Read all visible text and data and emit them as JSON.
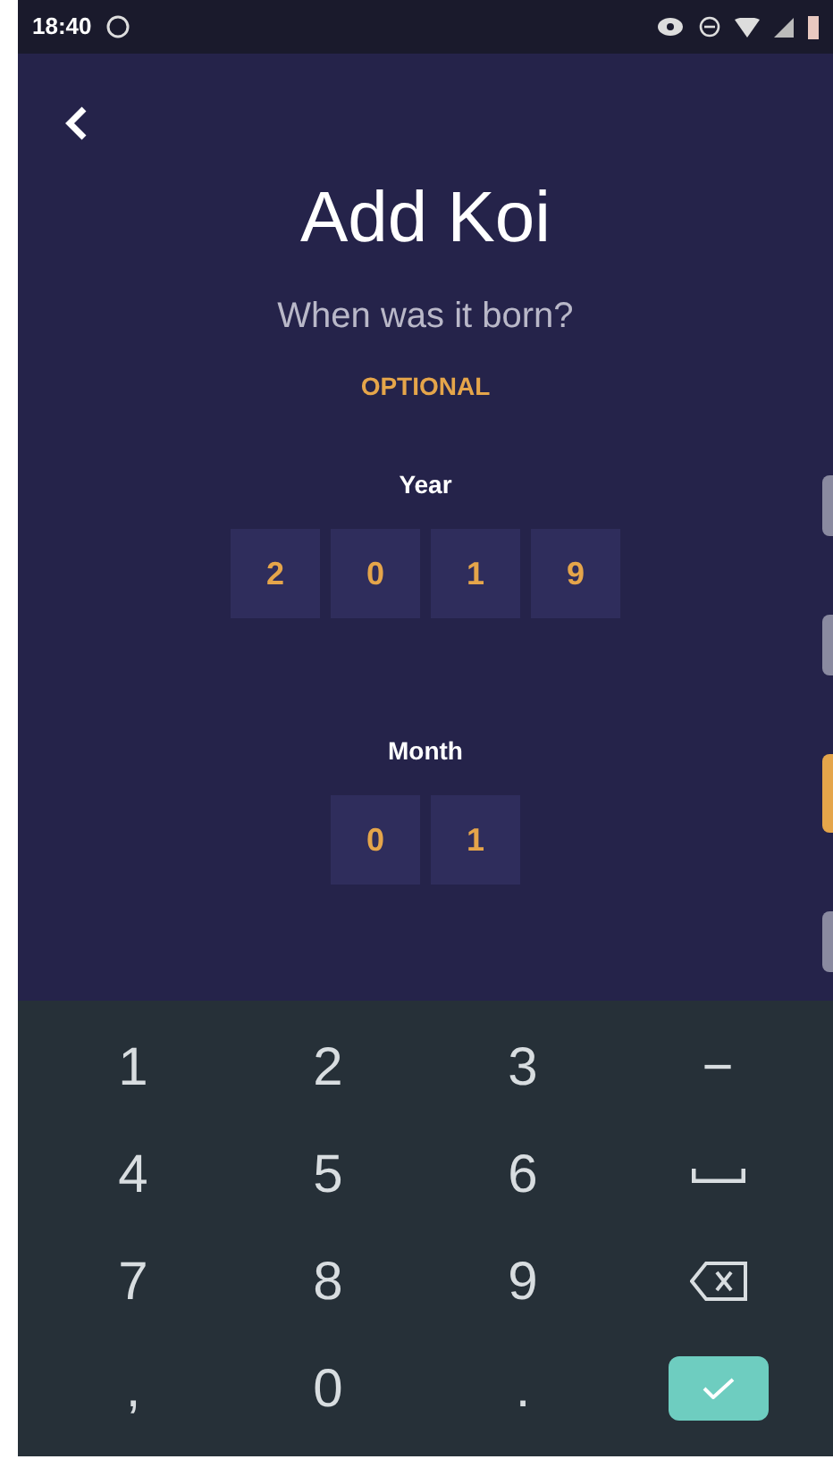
{
  "status_bar": {
    "time": "18:40"
  },
  "header": {
    "title": "Add Koi",
    "subtitle": "When was it born?",
    "note": "OPTIONAL"
  },
  "fields": [
    {
      "label": "Year",
      "digits": [
        "2",
        "0",
        "1",
        "9"
      ]
    },
    {
      "label": "Month",
      "digits": [
        "0",
        "1"
      ]
    }
  ],
  "steps": [
    {
      "selected": false
    },
    {
      "selected": false
    },
    {
      "selected": true
    },
    {
      "selected": false
    }
  ],
  "keyboard": [
    {
      "kind": "char",
      "label": "1"
    },
    {
      "kind": "char",
      "label": "2"
    },
    {
      "kind": "char",
      "label": "3"
    },
    {
      "kind": "char",
      "label": "−"
    },
    {
      "kind": "char",
      "label": "4"
    },
    {
      "kind": "char",
      "label": "5"
    },
    {
      "kind": "char",
      "label": "6"
    },
    {
      "kind": "space"
    },
    {
      "kind": "char",
      "label": "7"
    },
    {
      "kind": "char",
      "label": "8"
    },
    {
      "kind": "char",
      "label": "9"
    },
    {
      "kind": "backspace"
    },
    {
      "kind": "char",
      "label": ","
    },
    {
      "kind": "char",
      "label": "0"
    },
    {
      "kind": "char",
      "label": "."
    },
    {
      "kind": "done"
    }
  ]
}
